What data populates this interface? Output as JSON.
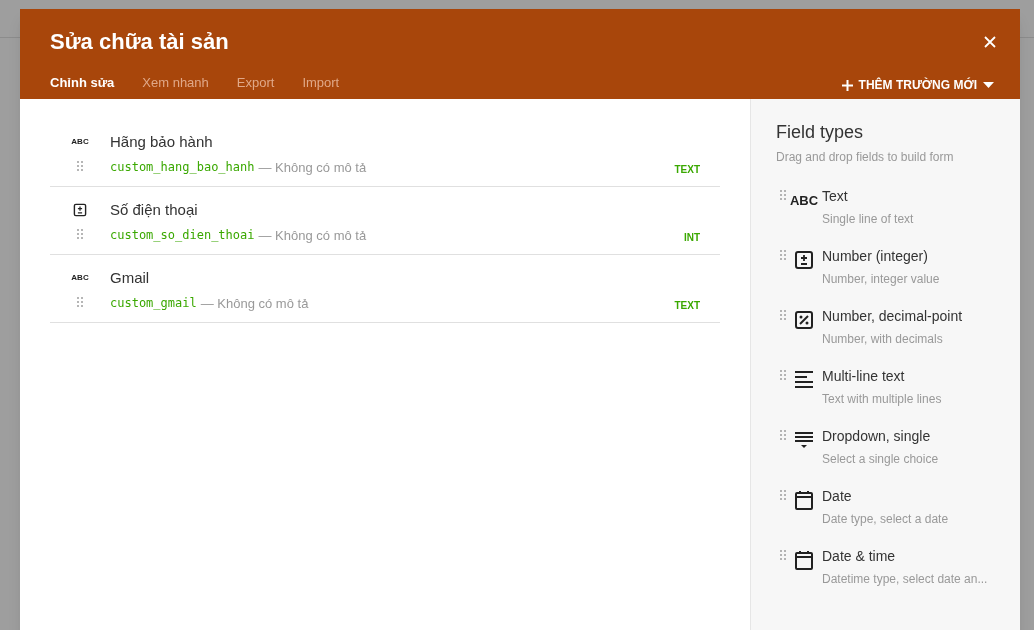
{
  "dialog": {
    "title": "Sửa chữa tài sản",
    "tabs": [
      {
        "label": "Chỉnh sửa",
        "selected": true
      },
      {
        "label": "Xem nhanh",
        "selected": false
      },
      {
        "label": "Export",
        "selected": false
      },
      {
        "label": "Import",
        "selected": false
      }
    ],
    "add_field_button": "THÊM TRƯỜNG MỚI"
  },
  "fields": [
    {
      "kind": "text",
      "icon_label": "ABC",
      "name": "Hãng bảo hành",
      "key": "custom_hang_bao_hanh",
      "description": "— Không có mô tả",
      "type": "TEXT"
    },
    {
      "kind": "integer",
      "name": "Số điện thoại",
      "key": "custom_so_dien_thoai",
      "description": "— Không có mô tả",
      "type": "INT"
    },
    {
      "kind": "text",
      "icon_label": "ABC",
      "name": "Gmail",
      "key": "custom_gmail",
      "description": "— Không có mô tả",
      "type": "TEXT"
    }
  ],
  "field_types": {
    "title": "Field types",
    "subtitle": "Drag and drop fields to build form",
    "items": [
      {
        "kind": "text",
        "icon_label": "ABC",
        "name": "Text",
        "description": "Single line of text"
      },
      {
        "kind": "integer",
        "name": "Number (integer)",
        "description": "Number, integer value"
      },
      {
        "kind": "decimal",
        "name": "Number, decimal-point",
        "description": "Number, with decimals"
      },
      {
        "kind": "multiline",
        "name": "Multi-line text",
        "description": "Text with multiple lines"
      },
      {
        "kind": "dropdown",
        "name": "Dropdown, single",
        "description": "Select a single choice"
      },
      {
        "kind": "date",
        "name": "Date",
        "description": "Date type, select a date"
      },
      {
        "kind": "datetime",
        "name": "Date & time",
        "description": "Datetime type, select date an..."
      }
    ]
  }
}
